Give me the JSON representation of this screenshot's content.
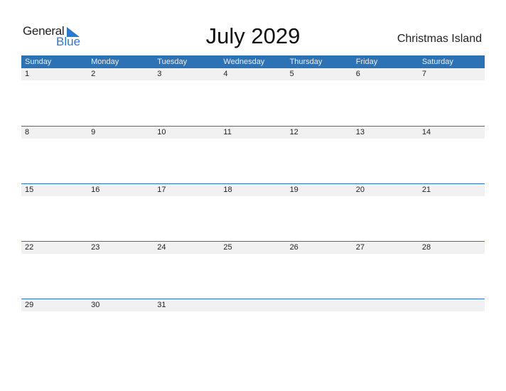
{
  "logo": {
    "general": "General",
    "blue": "Blue",
    "icon": "triangle-flag-icon"
  },
  "header": {
    "title": "July 2029",
    "country": "Christmas Island"
  },
  "weekdays": [
    "Sunday",
    "Monday",
    "Tuesday",
    "Wednesday",
    "Thursday",
    "Friday",
    "Saturday"
  ],
  "weeks": [
    [
      "1",
      "2",
      "3",
      "4",
      "5",
      "6",
      "7"
    ],
    [
      "8",
      "9",
      "10",
      "11",
      "12",
      "13",
      "14"
    ],
    [
      "15",
      "16",
      "17",
      "18",
      "19",
      "20",
      "21"
    ],
    [
      "22",
      "23",
      "24",
      "25",
      "26",
      "27",
      "28"
    ],
    [
      "29",
      "30",
      "31",
      "",
      "",
      "",
      ""
    ]
  ],
  "colors": {
    "accent": "#2e72b6",
    "strip": "#f1f1f1",
    "logo_blue": "#2a7bd0"
  }
}
